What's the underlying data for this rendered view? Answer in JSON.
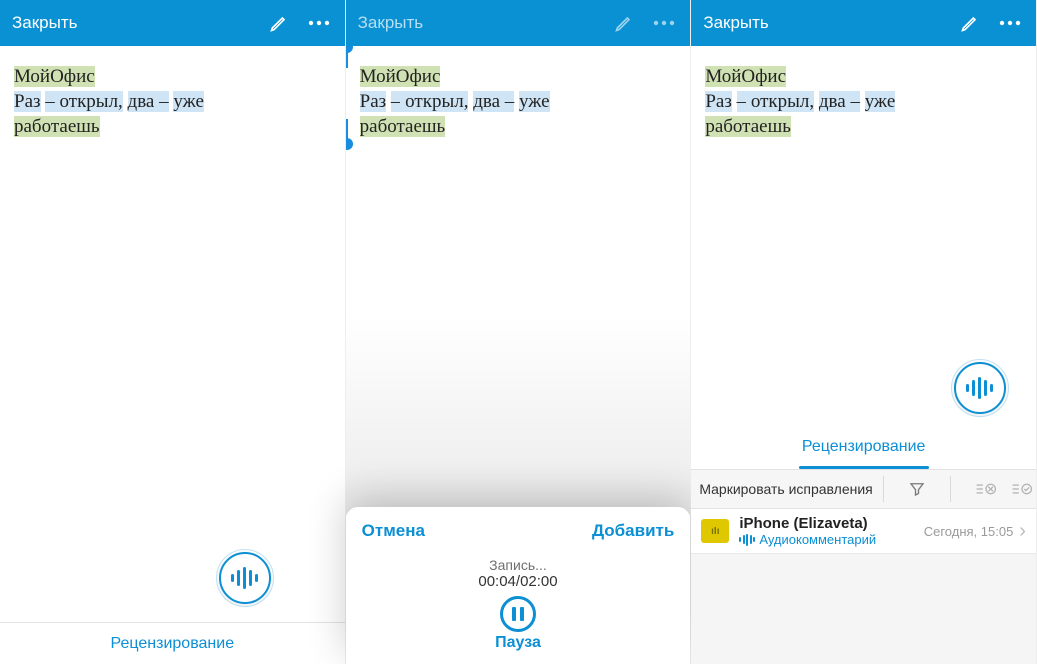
{
  "common": {
    "close": "Закрыть",
    "doc_title": "МойОфис",
    "doc_line_raz": "Раз",
    "doc_line_dash": "–",
    "doc_line_opened": "открыл,",
    "doc_line_two": "два",
    "doc_line_already": "уже",
    "doc_line_working": "работаешь"
  },
  "screen1": {
    "tab_label": "Рецензирование"
  },
  "screen2": {
    "cancel": "Отмена",
    "add": "Добавить",
    "status": "Запись...",
    "time": "00:04/02:00",
    "pause": "Пауза"
  },
  "screen3": {
    "panel_title": "Рецензирование",
    "mark_label": "Маркировать исправления",
    "comment_author": "iPhone (Elizaveta)",
    "comment_type": "Аудиокомментарий",
    "comment_date": "Сегодня, 15:05"
  }
}
